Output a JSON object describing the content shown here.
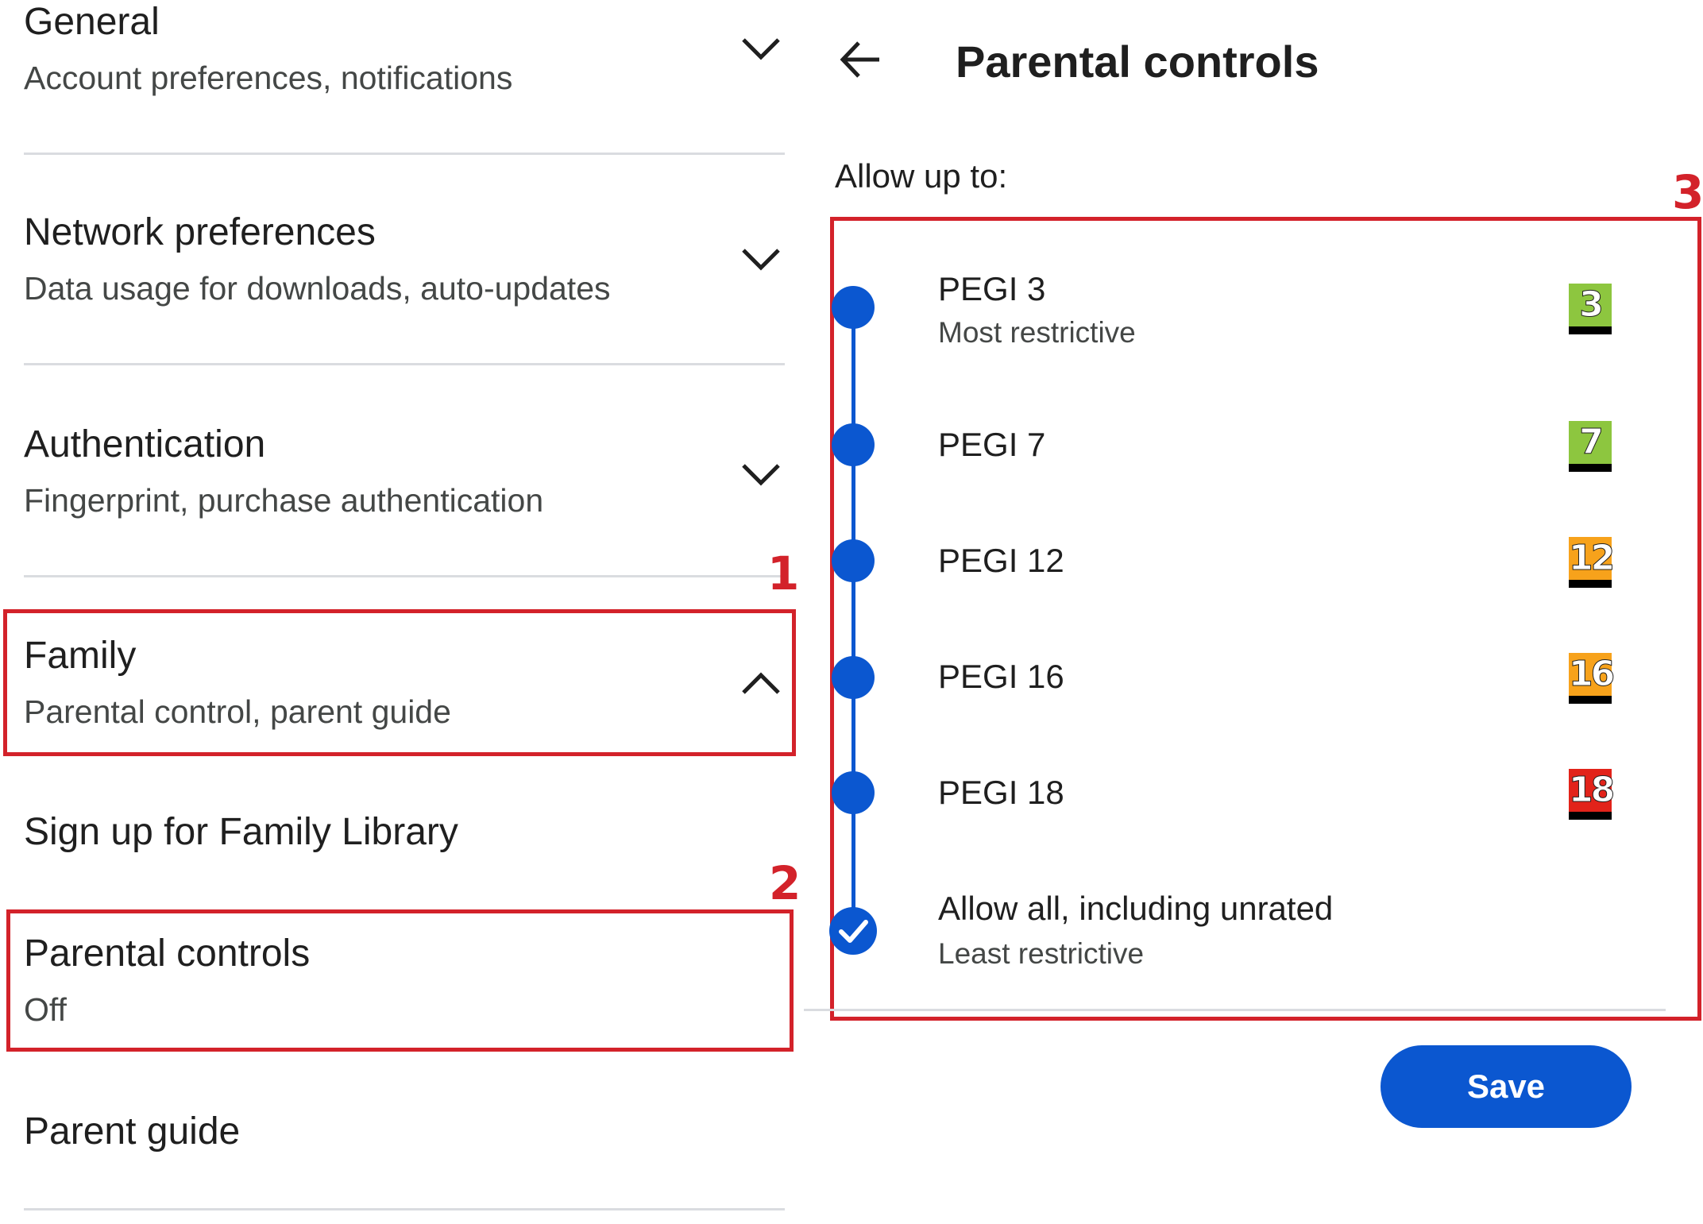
{
  "settings": {
    "general": {
      "title": "General",
      "subtitle": "Account preferences, notifications",
      "chevron": "chevron-down-icon"
    },
    "network": {
      "title": "Network preferences",
      "subtitle": "Data usage for downloads, auto-updates",
      "chevron": "chevron-down-icon"
    },
    "authentication": {
      "title": "Authentication",
      "subtitle": "Fingerprint, purchase authentication",
      "chevron": "chevron-down-icon"
    },
    "family": {
      "title": "Family",
      "subtitle": "Parental control, parent guide",
      "chevron": "chevron-up-icon"
    },
    "family_library": {
      "title": "Sign up for Family Library"
    },
    "parental_controls": {
      "title": "Parental controls",
      "subtitle": "Off"
    },
    "parent_guide": {
      "title": "Parent guide"
    }
  },
  "annotations": {
    "one": "1",
    "two": "2",
    "three": "3",
    "color": "#d3222a"
  },
  "panel": {
    "title": "Parental controls",
    "allow_label": "Allow up to:",
    "options": [
      {
        "title": "PEGI 3",
        "subtitle": "Most restrictive",
        "badge": "3",
        "badge_color": "#8dc63f"
      },
      {
        "title": "PEGI 7",
        "badge": "7",
        "badge_color": "#8dc63f"
      },
      {
        "title": "PEGI 12",
        "badge": "12",
        "badge_color": "#f7a21b"
      },
      {
        "title": "PEGI 16",
        "badge": "16",
        "badge_color": "#f7a21b"
      },
      {
        "title": "PEGI 18",
        "badge": "18",
        "badge_color": "#e2231a"
      },
      {
        "title": "Allow all, including unrated",
        "subtitle": "Least restrictive",
        "selected": true
      }
    ],
    "save_label": "Save",
    "accent_color": "#0b57d0"
  }
}
